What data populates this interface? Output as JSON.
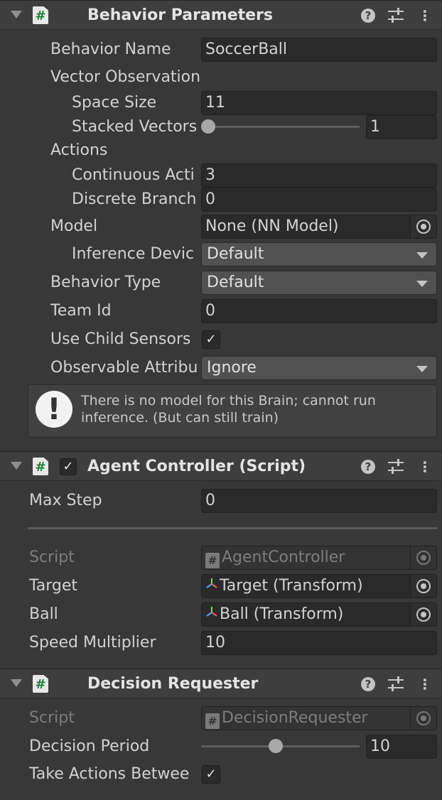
{
  "behavior_parameters": {
    "title": "Behavior Parameters",
    "behavior_name_label": "Behavior Name",
    "behavior_name_value": "SoccerBall",
    "vector_observation_label": "Vector Observation",
    "space_size_label": "Space Size",
    "space_size_value": "11",
    "stacked_vectors_label": "Stacked Vectors",
    "stacked_vectors_value": "1",
    "stacked_vectors_slider_fraction": 0.0,
    "actions_label": "Actions",
    "continuous_actions_label": "Continuous Acti",
    "continuous_actions_value": "3",
    "discrete_branches_label": "Discrete Branch",
    "discrete_branches_value": "0",
    "model_label": "Model",
    "model_value": "None (NN Model)",
    "inference_device_label": "Inference Devic",
    "inference_device_value": "Default",
    "behavior_type_label": "Behavior Type",
    "behavior_type_value": "Default",
    "team_id_label": "Team Id",
    "team_id_value": "0",
    "use_child_sensors_label": "Use Child Sensors",
    "use_child_sensors_checked": true,
    "observable_attributes_label": "Observable Attribu",
    "observable_attributes_value": "Ignore",
    "help_message": "There is no model for this Brain; cannot run inference. (But can still train)"
  },
  "agent_controller": {
    "title": "Agent Controller (Script)",
    "enabled": true,
    "max_step_label": "Max Step",
    "max_step_value": "0",
    "script_label": "Script",
    "script_value": "AgentController",
    "target_label": "Target",
    "target_value": "Target (Transform)",
    "ball_label": "Ball",
    "ball_value": "Ball (Transform)",
    "speed_multiplier_label": "Speed Multiplier",
    "speed_multiplier_value": "10"
  },
  "decision_requester": {
    "title": "Decision Requester",
    "script_label": "Script",
    "script_value": "DecisionRequester",
    "decision_period_label": "Decision Period",
    "decision_period_value": "10",
    "decision_period_slider_fraction": 0.47,
    "take_actions_label": "Take Actions Betwee",
    "take_actions_checked": true
  },
  "icons": {
    "check_glyph": "✓",
    "help_glyph": "?",
    "kebab_glyph": "⋮",
    "warning_glyph": "!",
    "script_glyph": "#"
  },
  "colors": {
    "background": "#383838",
    "header": "#3e3e3e",
    "field": "#2a2a2a",
    "dropdown": "#515151",
    "text": "#d2d2d2",
    "dim_text": "#7d7d7d",
    "script_icon_green": "#1f7f3a"
  }
}
